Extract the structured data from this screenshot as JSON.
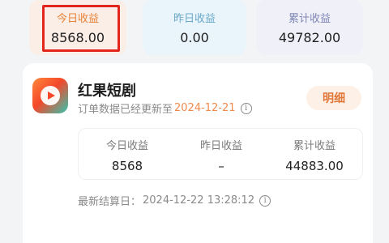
{
  "summary": {
    "today_label": "今日收益",
    "today_value": "8568.00",
    "yesterday_label": "昨日收益",
    "yesterday_value": "0.00",
    "total_label": "累计收益",
    "total_value": "49782.00"
  },
  "app": {
    "name": "红果短剧",
    "icon": "play-icon",
    "update_prefix": "订单数据已经更新至",
    "update_date": "2024-12-21",
    "detail_label": "明细",
    "stats": {
      "today_label": "今日收益",
      "today_value": "8568",
      "yesterday_label": "昨日收益",
      "yesterday_value": "–",
      "total_label": "累计收益",
      "total_value": "44883.00"
    },
    "settle_prefix": "最新结算日：",
    "settle_time": "2024-12-22 13:28:12"
  },
  "colors": {
    "highlight_border": "#e3261d",
    "accent_orange": "#e8833a"
  }
}
